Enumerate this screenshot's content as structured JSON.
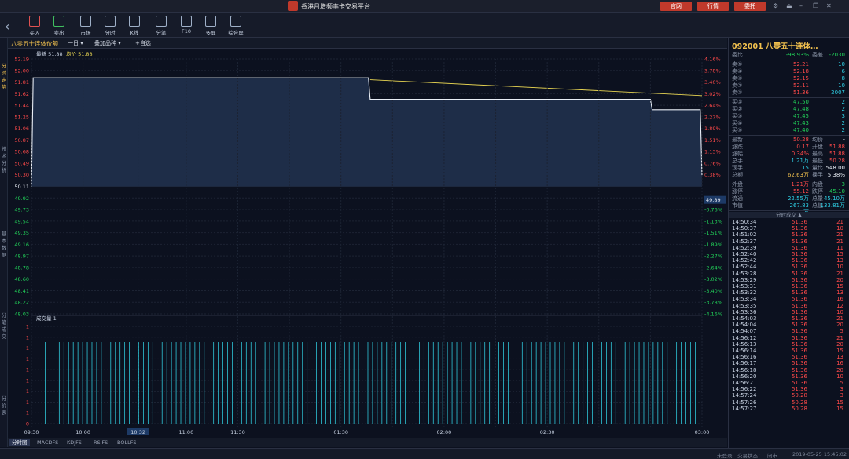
{
  "window": {
    "title": "香港月增频率卡交易平台",
    "btn_official": "官网",
    "btn_market": "行情",
    "btn_trade": "委托"
  },
  "toolbar": {
    "items": [
      {
        "label": "买入",
        "icon": "buy-icon"
      },
      {
        "label": "卖出",
        "icon": "sell-icon"
      },
      {
        "label": "市场",
        "icon": "market-icon"
      },
      {
        "label": "分时",
        "icon": "timeshare-icon"
      },
      {
        "label": "K线",
        "icon": "kline-icon"
      },
      {
        "label": "分笔",
        "icon": "ticks-icon"
      },
      {
        "label": "F10",
        "icon": "f10-icon"
      },
      {
        "label": "多屏",
        "icon": "multiscreen-icon"
      },
      {
        "label": "综合屏",
        "icon": "dashboard-icon"
      }
    ]
  },
  "leftnav": [
    "分时走势",
    "技术分析",
    "基本数据",
    "分笔成交",
    "分价表"
  ],
  "chartbar": {
    "name": "八零五十连体价额",
    "period": "一日",
    "overlay": "叠加品种",
    "add": "+自选"
  },
  "legend": {
    "latest_label": "最新",
    "latest": "51.88",
    "avg_label": "均价",
    "avg": "51.88"
  },
  "volume_label": "成交量 1",
  "bottom_tabs": [
    "分时图",
    "MACDFS",
    "KDJFS",
    "RSIFS",
    "BOLLFS"
  ],
  "status": {
    "a": "未登录",
    "b": "交易状态：",
    "c": "闭市",
    "time": "2019-05-25 15:45:02"
  },
  "chart_data": {
    "type": "line",
    "prev_close": 50.11,
    "y_ticks_left": [
      "52.19",
      "52.00",
      "51.81",
      "51.62",
      "51.44",
      "51.25",
      "51.06",
      "50.87",
      "50.68",
      "50.49",
      "50.30",
      "50.11",
      "49.92",
      "49.73",
      "49.54",
      "49.35",
      "49.16",
      "48.97",
      "48.78",
      "48.60",
      "48.41",
      "48.22",
      "48.03"
    ],
    "y_ticks_right": [
      "4.16%",
      "3.78%",
      "3.40%",
      "3.02%",
      "2.64%",
      "2.27%",
      "1.89%",
      "1.51%",
      "1.13%",
      "0.76%",
      "0.38%",
      "0.00%",
      "-0.76%",
      "-1.13%",
      "-1.51%",
      "-1.89%",
      "-2.27%",
      "-2.64%",
      "-3.02%",
      "-3.40%",
      "-3.78%",
      "-4.16%"
    ],
    "current_marker": "49.89",
    "x_labels": [
      "09:30",
      "10:00",
      "10:32",
      "11:00",
      "11:30",
      "01:30",
      "02:00",
      "02:30",
      "03:00"
    ],
    "volume_ticks": [
      "1",
      "1",
      "1",
      "1",
      "1",
      "1",
      "1",
      "1",
      "1",
      "0"
    ],
    "price_series": [
      {
        "t": 0,
        "v": 50.11
      },
      {
        "t": 1,
        "v": 51.88
      },
      {
        "t": 196,
        "v": 51.88
      },
      {
        "t": 197,
        "v": 51.53
      },
      {
        "t": 360,
        "v": 51.53
      },
      {
        "t": 361,
        "v": 51.36
      },
      {
        "t": 389,
        "v": 51.36
      },
      {
        "t": 390,
        "v": 50.28
      }
    ],
    "avg_series": [
      {
        "t": 197,
        "v": 51.85
      },
      {
        "t": 390,
        "v": 51.59
      }
    ]
  },
  "quote": {
    "code": "092001",
    "name": "八零五十连体…",
    "ratio": {
      "l": "委比",
      "m": "-98.93%",
      "r_l": "委差",
      "r": "-2030"
    },
    "asks": [
      {
        "l": "卖⑤",
        "p": "52.21",
        "v": "10"
      },
      {
        "l": "卖④",
        "p": "52.18",
        "v": "6"
      },
      {
        "l": "卖③",
        "p": "52.15",
        "v": "8"
      },
      {
        "l": "卖②",
        "p": "52.11",
        "v": "10"
      },
      {
        "l": "卖①",
        "p": "51.36",
        "v": "2007"
      }
    ],
    "bids": [
      {
        "l": "买①",
        "p": "47.50",
        "v": "2"
      },
      {
        "l": "买②",
        "p": "47.48",
        "v": "2"
      },
      {
        "l": "买③",
        "p": "47.45",
        "v": "3"
      },
      {
        "l": "买④",
        "p": "47.43",
        "v": "2"
      },
      {
        "l": "买⑤",
        "p": "47.40",
        "v": "2"
      }
    ],
    "stats": [
      {
        "l": "最新",
        "m": "50.28",
        "rl": "均价",
        "r": "-"
      },
      {
        "l": "涨跌",
        "m": "0.17",
        "rl": "开盘",
        "r": "51.88"
      },
      {
        "l": "涨幅",
        "m": "0.34%",
        "rl": "最高",
        "r": "51.88"
      },
      {
        "l": "总手",
        "m": "1.21万",
        "rl": "最低",
        "r": "50.28"
      },
      {
        "l": "现手",
        "m": "15",
        "rl": "量比",
        "r": "548.00"
      },
      {
        "l": "总额",
        "m": "62.63万",
        "rl": "换手",
        "r": "5.38%"
      },
      {
        "l": "外盘",
        "m": "1.21万",
        "rl": "内盘",
        "r": "3"
      },
      {
        "l": "涨停",
        "m": "55.12",
        "rl": "跌停",
        "r": "45.10"
      },
      {
        "l": "流通",
        "m": "22.55万",
        "rl": "总量",
        "r": "45.10万"
      },
      {
        "l": "市值",
        "m": "267.83万",
        "rl": "总值",
        "r": "133.81万"
      }
    ],
    "ticks_title": "分时成交",
    "ticks": [
      {
        "t": "14:50:34",
        "p": "51.36",
        "v": "21"
      },
      {
        "t": "14:50:37",
        "p": "51.36",
        "v": "10"
      },
      {
        "t": "14:51:02",
        "p": "51.36",
        "v": "21"
      },
      {
        "t": "14:52:37",
        "p": "51.36",
        "v": "21"
      },
      {
        "t": "14:52:39",
        "p": "51.36",
        "v": "11"
      },
      {
        "t": "14:52:40",
        "p": "51.36",
        "v": "15"
      },
      {
        "t": "14:52:42",
        "p": "51.36",
        "v": "13"
      },
      {
        "t": "14:52:44",
        "p": "51.36",
        "v": "10"
      },
      {
        "t": "14:53:28",
        "p": "51.36",
        "v": "21"
      },
      {
        "t": "14:53:29",
        "p": "51.36",
        "v": "20"
      },
      {
        "t": "14:53:31",
        "p": "51.36",
        "v": "15"
      },
      {
        "t": "14:53:32",
        "p": "51.36",
        "v": "13"
      },
      {
        "t": "14:53:34",
        "p": "51.36",
        "v": "16"
      },
      {
        "t": "14:53:35",
        "p": "51.36",
        "v": "12"
      },
      {
        "t": "14:53:36",
        "p": "51.36",
        "v": "10"
      },
      {
        "t": "14:54:03",
        "p": "51.36",
        "v": "21"
      },
      {
        "t": "14:54:04",
        "p": "51.36",
        "v": "20"
      },
      {
        "t": "14:54:07",
        "p": "51.36",
        "v": "5"
      },
      {
        "t": "14:56:12",
        "p": "51.36",
        "v": "21"
      },
      {
        "t": "14:56:13",
        "p": "51.36",
        "v": "20"
      },
      {
        "t": "14:56:14",
        "p": "51.36",
        "v": "15"
      },
      {
        "t": "14:56:16",
        "p": "51.36",
        "v": "13"
      },
      {
        "t": "14:56:17",
        "p": "51.36",
        "v": "16"
      },
      {
        "t": "14:56:18",
        "p": "51.36",
        "v": "20"
      },
      {
        "t": "14:56:20",
        "p": "51.36",
        "v": "10"
      },
      {
        "t": "14:56:21",
        "p": "51.36",
        "v": "5"
      },
      {
        "t": "14:56:22",
        "p": "51.36",
        "v": "3"
      },
      {
        "t": "14:57:24",
        "p": "50.28",
        "v": "3"
      },
      {
        "t": "14:57:26",
        "p": "50.28",
        "v": "15"
      },
      {
        "t": "14:57:27",
        "p": "50.28",
        "v": "15"
      }
    ]
  }
}
